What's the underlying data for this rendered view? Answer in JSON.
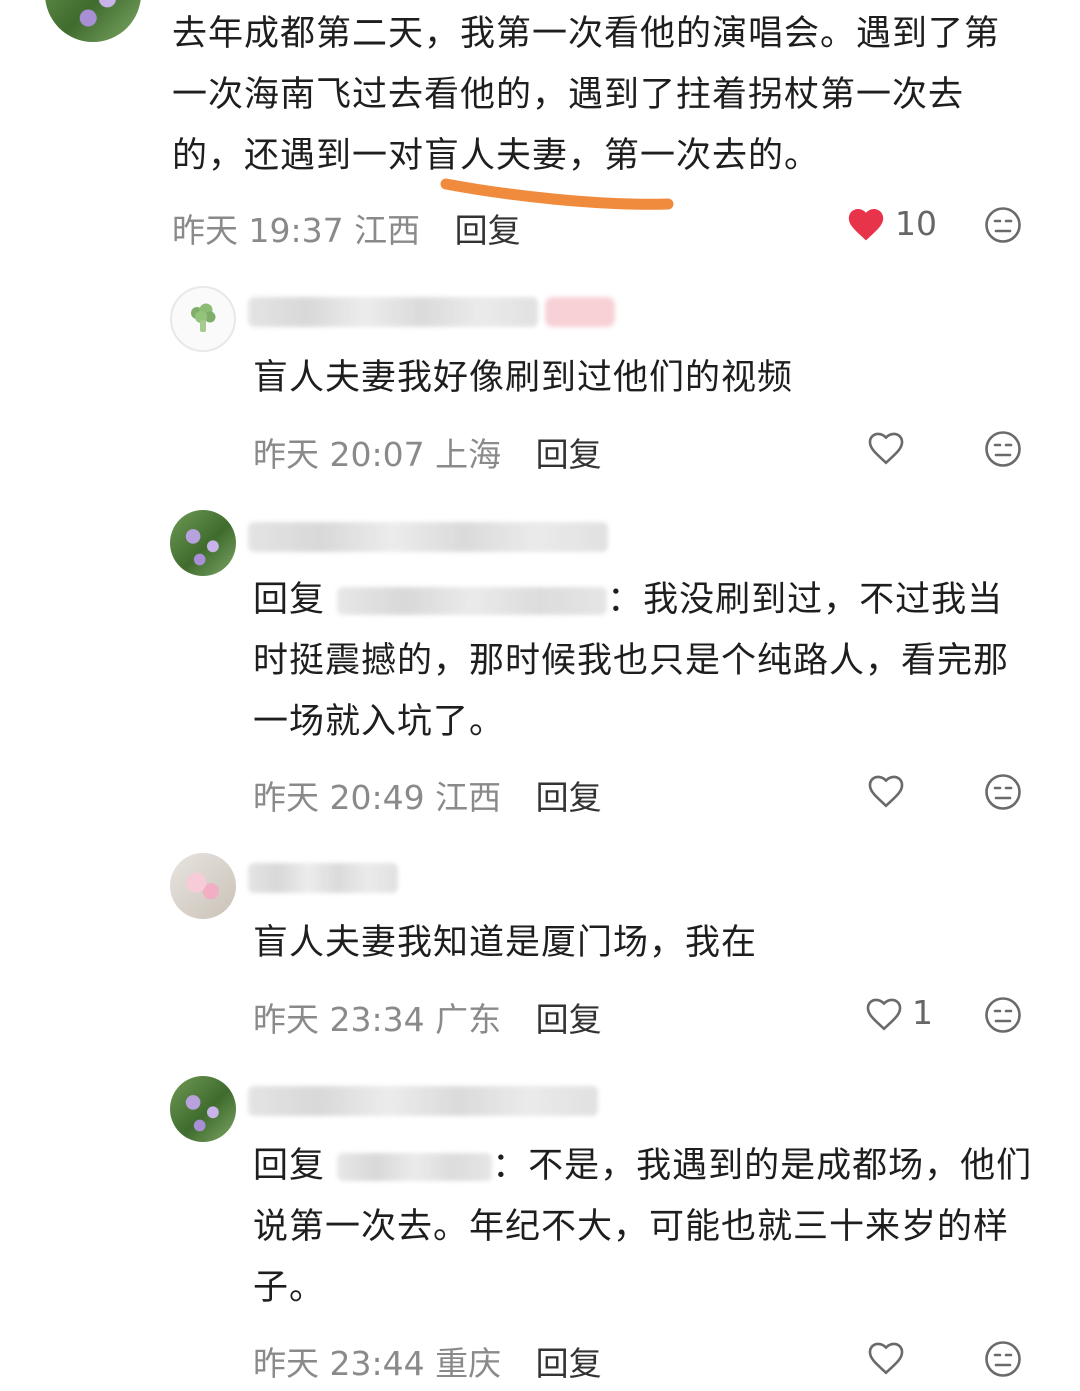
{
  "comments": [
    {
      "text": "去年成都第二天，我第一次看他的演唱会。遇到了第一次海南飞过去看他的，遇到了拄着拐杖第一次去的，还遇到一对盲人夫妻，第一次去的。",
      "time": "昨天 19:37",
      "location": "江西",
      "reply_label": "回复",
      "likes": "10",
      "liked": true
    },
    {
      "text": "盲人夫妻我好像刷到过他们的视频",
      "time": "昨天 20:07",
      "location": "上海",
      "reply_label": "回复",
      "likes": ""
    },
    {
      "reply_prefix": "回复",
      "text_after_name": "：我没刷到过，不过我当时挺震撼的，那时候我也只是个纯路人，看完那一场就入坑了。",
      "time": "昨天 20:49",
      "location": "江西",
      "reply_label": "回复",
      "likes": ""
    },
    {
      "text": "盲人夫妻我知道是厦门场，我在",
      "time": "昨天 23:34",
      "location": "广东",
      "reply_label": "回复",
      "likes": "1"
    },
    {
      "reply_prefix": "回复",
      "text_after_name": "：不是，我遇到的是成都场，他们说第一次去。年纪不大，可能也就三十来岁的样子。",
      "time": "昨天 23:44",
      "location": "重庆",
      "reply_label": "回复",
      "likes": ""
    }
  ],
  "icons": {
    "like": "heart-icon",
    "liked": "heart-filled-icon",
    "dislike": "meh-face-icon",
    "avatar_broccoli": "broccoli-icon"
  },
  "colors": {
    "liked_heart": "#e8344a",
    "highlight_underline": "#f08a3c",
    "meta_gray": "#8a8a8a"
  }
}
